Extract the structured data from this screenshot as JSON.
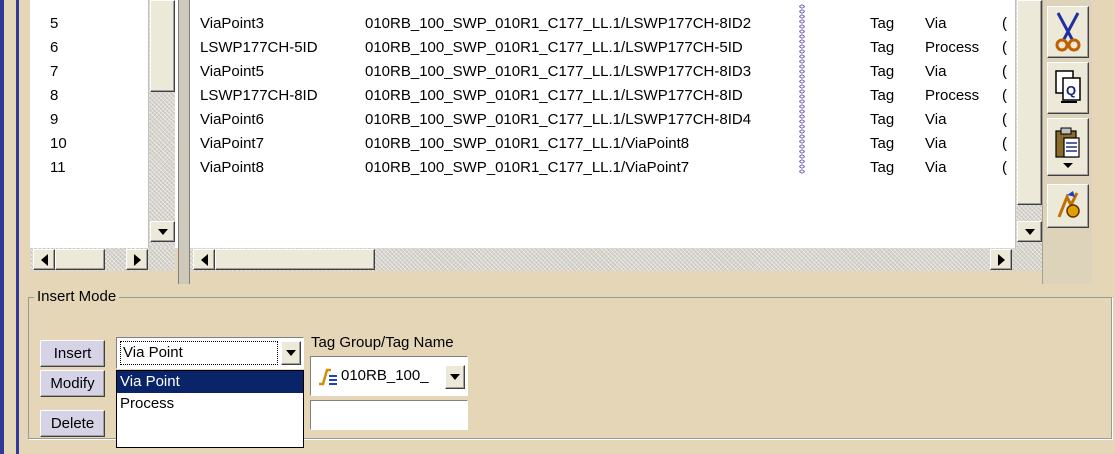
{
  "left_list": {
    "rows": [
      "5",
      "6",
      "7",
      "8",
      "9",
      "10",
      "11"
    ]
  },
  "table": {
    "rows": [
      {
        "name": "ViaPoint3",
        "path": "010RB_100_SWP_010R1_C177_LL.1/LSWP177CH-8ID2",
        "tag": "Tag",
        "type": "Via",
        "extra": "("
      },
      {
        "name": "LSWP177CH-5ID",
        "path": "010RB_100_SWP_010R1_C177_LL.1/LSWP177CH-5ID",
        "tag": "Tag",
        "type": "Process",
        "extra": "("
      },
      {
        "name": "ViaPoint5",
        "path": "010RB_100_SWP_010R1_C177_LL.1/LSWP177CH-8ID3",
        "tag": "Tag",
        "type": "Via",
        "extra": "("
      },
      {
        "name": "LSWP177CH-8ID",
        "path": "010RB_100_SWP_010R1_C177_LL.1/LSWP177CH-8ID",
        "tag": "Tag",
        "type": "Process",
        "extra": "("
      },
      {
        "name": "ViaPoint6",
        "path": "010RB_100_SWP_010R1_C177_LL.1/LSWP177CH-8ID4",
        "tag": "Tag",
        "type": "Via",
        "extra": "("
      },
      {
        "name": "ViaPoint7",
        "path": "010RB_100_SWP_010R1_C177_LL.1/ViaPoint8",
        "tag": "Tag",
        "type": "Via",
        "extra": "("
      },
      {
        "name": "ViaPoint8",
        "path": "010RB_100_SWP_010R1_C177_LL.1/ViaPoint7",
        "tag": "Tag",
        "type": "Via",
        "extra": "("
      }
    ]
  },
  "toolbar": {
    "icons": [
      "scissors-icon",
      "copy-icon",
      "paste-icon",
      "special-icon"
    ]
  },
  "insert_mode": {
    "legend": "Insert Mode",
    "insert_label": "Insert",
    "modify_label": "Modify",
    "delete_label": "Delete",
    "mode_select_value": "Via Point",
    "mode_options": [
      "Via Point",
      "Process"
    ],
    "tag_group_label": "Tag Group/Tag Name",
    "tag_group_value": "010RB_100_",
    "tag_name_value": ""
  },
  "colors": {
    "background": "#e5d6b8",
    "frame": "#30399a",
    "selection": "#0a246a",
    "chain": "#6a52b3"
  }
}
